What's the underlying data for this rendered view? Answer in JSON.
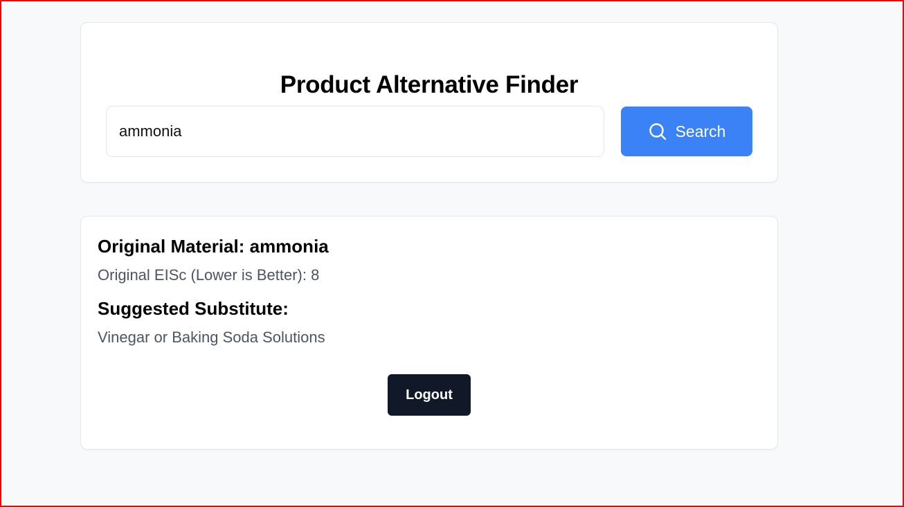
{
  "app": {
    "title": "Product Alternative Finder"
  },
  "search": {
    "value": "ammonia",
    "button_label": "Search",
    "icon": "search-icon"
  },
  "result": {
    "original_label": "Original Material: ammonia",
    "eisc_text": "Original EISc (Lower is Better): 8",
    "substitute_heading": "Suggested Substitute:",
    "substitute_value": "Vinegar or Baking Soda Solutions"
  },
  "actions": {
    "logout_label": "Logout"
  },
  "colors": {
    "accent": "#3b82f6",
    "dark_button": "#111827",
    "background": "#f8f9fa",
    "frame_border": "#ff0000"
  }
}
